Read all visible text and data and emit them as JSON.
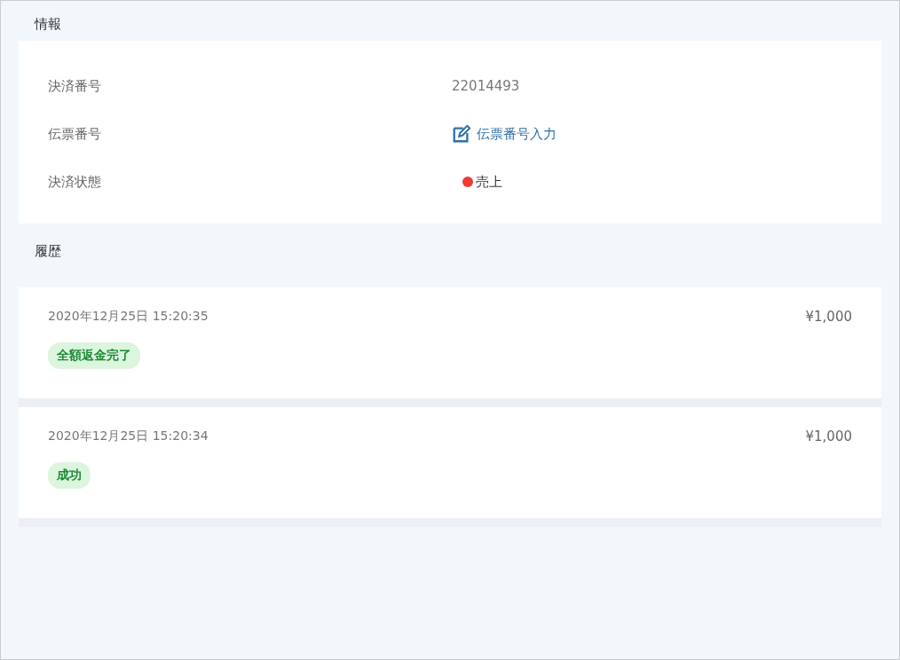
{
  "info": {
    "title": "情報",
    "rows": [
      {
        "label": "決済番号",
        "kind": "text",
        "value": "22014493"
      },
      {
        "label": "伝票番号",
        "kind": "link",
        "value": "伝票番号入力"
      },
      {
        "label": "決済状態",
        "kind": "status",
        "value": "売上",
        "color": "#f03c32"
      }
    ]
  },
  "history": {
    "title": "履歴",
    "items": [
      {
        "datetime": "2020年12月25日 15:20:35",
        "amount": "¥1,000",
        "tag": "全額返金完了"
      },
      {
        "datetime": "2020年12月25日 15:20:34",
        "amount": "¥1,000",
        "tag": "成功"
      }
    ]
  }
}
